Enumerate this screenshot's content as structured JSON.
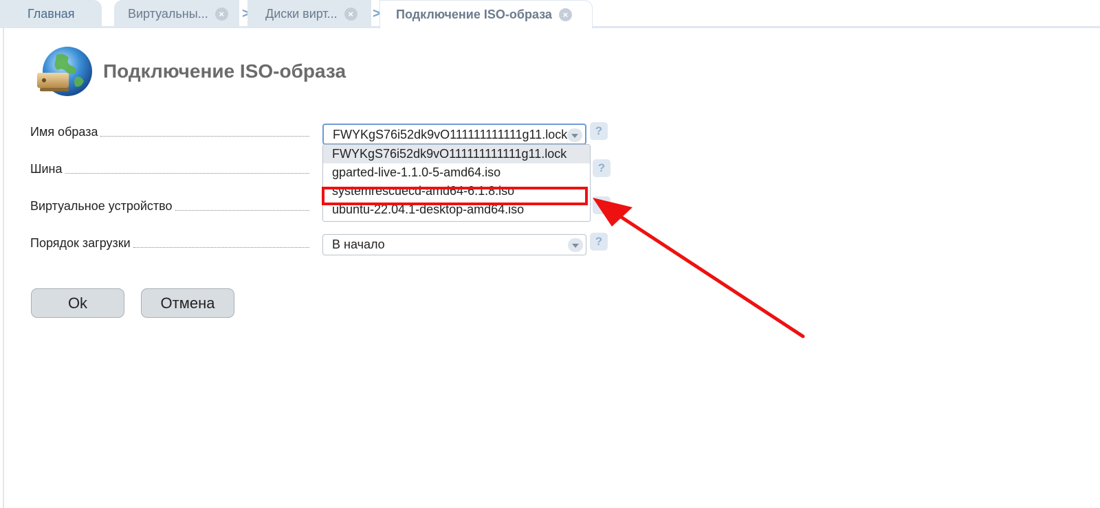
{
  "tabs": {
    "home": "Главная",
    "virtual_machines": "Виртуальны...",
    "virtual_disks": "Диски вирт...",
    "active": "Подключение ISO-образа"
  },
  "page": {
    "title": "Подключение ISO-образа"
  },
  "form": {
    "image_name": {
      "label": "Имя образа",
      "value": "FWYKgS76i52dk9vO111111111111g11.lock",
      "options": [
        "FWYKgS76i52dk9vO111111111111g11.lock",
        "gparted-live-1.1.0-5-amd64.iso",
        "systemrescuecd-amd64-6.1.8.iso",
        "ubuntu-22.04.1-desktop-amd64.iso"
      ]
    },
    "bus": {
      "label": "Шина"
    },
    "virtual_device": {
      "label": "Виртуальное устройство"
    },
    "boot_order": {
      "label": "Порядок загрузки",
      "value": "В начало"
    },
    "help_symbol": "?"
  },
  "buttons": {
    "ok": "Ok",
    "cancel": "Отмена"
  },
  "close_symbol": "×",
  "chevron_symbol": ">",
  "colors": {
    "tab_bg": "#dfe7ef",
    "annotation": "#ee1111",
    "focus": "#6f9ad0"
  }
}
